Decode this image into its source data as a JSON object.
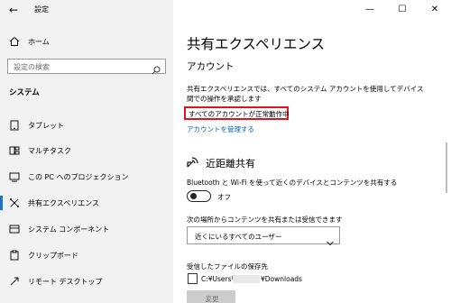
{
  "window": {
    "title": "設定",
    "minimize_glyph": "—",
    "maximize_glyph": "☐",
    "close_glyph": "✕"
  },
  "sidebar": {
    "home_label": "ホーム",
    "search_placeholder": "設定の検索",
    "section_title": "システム",
    "items": [
      {
        "label": "タブレット",
        "icon": "tablet-icon"
      },
      {
        "label": "マルチタスク",
        "icon": "multitask-icon"
      },
      {
        "label": "この PC へのプロジェクション",
        "icon": "projection-icon"
      },
      {
        "label": "共有エクスペリエンス",
        "icon": "shared-experience-icon",
        "active": true
      },
      {
        "label": "システム コンポーネント",
        "icon": "system-components-icon"
      },
      {
        "label": "クリップボード",
        "icon": "clipboard-icon"
      },
      {
        "label": "リモート デスクトップ",
        "icon": "remote-desktop-icon"
      }
    ]
  },
  "main": {
    "title": "共有エクスペリエンス",
    "account": {
      "heading": "アカウント",
      "description": "共有エクスペリエンスでは、すべてのシステム アカウントを使用してデバイス間での操作を承認します",
      "status": "すべてのアカウントが正常動作中",
      "manage_link": "アカウントを管理する"
    },
    "nearby": {
      "heading": "近距離共有",
      "description": "Bluetooth と Wi-Fi を使って近くのデバイスとコンテンツを共有する",
      "toggle_state": "オフ",
      "share_label": "次の場所からコンテンツを共有または受信できます",
      "share_option": "近くにいるすべてのユーザー"
    },
    "save": {
      "label": "受信したファイルの保存先",
      "path_prefix": "C:¥Users¥",
      "path_suffix": "¥Downloads",
      "change_button": "変更"
    }
  },
  "colors": {
    "accent": "#0067b8",
    "highlight": "#e0131e",
    "sidebar_bg": "#f2f2f2"
  }
}
